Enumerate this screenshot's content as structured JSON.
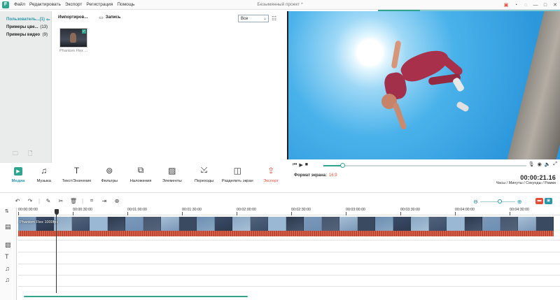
{
  "menu": [
    "Файл",
    "Редактировать",
    "Экспорт",
    "Регистрация",
    "Помощь"
  ],
  "window_title": "Безымянный проект *",
  "window_controls": {
    "alert": "🅂",
    "chat": "✉",
    "minimize": "—",
    "maximize": "□",
    "close": "✕"
  },
  "sidebar": {
    "items": [
      {
        "label": "Пользователь...",
        "count": "(1)"
      },
      {
        "label": "Примеры цве...",
        "count": "(13)"
      },
      {
        "label": "Примеры видео",
        "count": "(9)"
      }
    ]
  },
  "media": {
    "import_label": "Импортиров...",
    "record_label": "Запись",
    "filter_value": "Все",
    "items": [
      {
        "name": "Phantom Flex ..."
      }
    ]
  },
  "modules": [
    {
      "label": "Медиа",
      "icon": "media-icon"
    },
    {
      "label": "Музыка",
      "icon": "music-icon"
    },
    {
      "label": "Текст/Значение",
      "icon": "text-icon"
    },
    {
      "label": "Фильтры",
      "icon": "filters-icon"
    },
    {
      "label": "Наложения",
      "icon": "overlays-icon"
    },
    {
      "label": "Элементы",
      "icon": "elements-icon"
    },
    {
      "label": "Переходы",
      "icon": "transitions-icon"
    },
    {
      "label": "Разделить экран",
      "icon": "split-screen-icon"
    },
    {
      "label": "Экспорт",
      "icon": "export-icon"
    }
  ],
  "player": {
    "aspect_label": "Формат экрана:",
    "aspect_value": "16:9",
    "timecode": "00:00:21.16",
    "timecode_label": "Часы / Минуты / Секунды / Рамки",
    "progress": 0.095
  },
  "timeline": {
    "ruler": [
      "00:00:00:00",
      "00:00:30:00",
      "00:01:00:00",
      "00:01:30:00",
      "00:02:00:00",
      "00:02:30:00",
      "00:03:00:00",
      "00:03:30:00",
      "00:04:00:00",
      "00:04:30:00"
    ],
    "clip_label": "Phantom Flex 1000fps",
    "zoom_level": 0.56
  },
  "colors": {
    "accent": "#2fa58f",
    "accent_blue": "#2a94a8",
    "export_red": "#e0503c",
    "clip_red": "#d35d44"
  }
}
